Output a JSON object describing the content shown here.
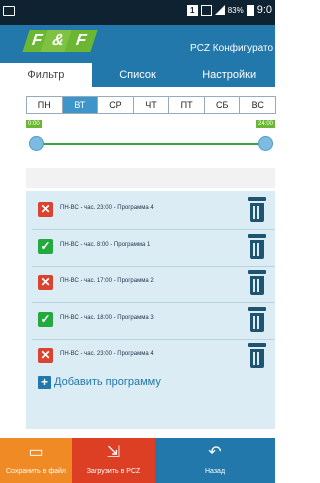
{
  "statusbar": {
    "indicator": "1",
    "battery": "83%",
    "time": "9:0"
  },
  "header": {
    "logo_text": "F&F",
    "title": "PCZ Конфигурато"
  },
  "tabs": [
    {
      "label": "Фильтр"
    },
    {
      "label": "Список"
    },
    {
      "label": "Настройки"
    }
  ],
  "days": [
    "ПН",
    "ВТ",
    "СР",
    "ЧТ",
    "ПТ",
    "СБ",
    "ВС"
  ],
  "selected_day": "ВТ",
  "slider": {
    "start": "0:00",
    "end": "24:00"
  },
  "programs": [
    {
      "text": "ПН-ВС - час. 23:00 - Программа 4",
      "checked": false
    },
    {
      "text": "ПН-ВС - час. 8:00 - Программа 1",
      "checked": true
    },
    {
      "text": "ПН-ВС - час. 17:00 - Программа 2",
      "checked": false
    },
    {
      "text": "ПН-ВС - час. 18:00 - Программа 3",
      "checked": true
    },
    {
      "text": "ПН-ВС - час. 23:00 - Программа 4",
      "checked": false
    }
  ],
  "add_program": "Добавить программу",
  "bottom": {
    "save": "Сохранить в файл",
    "upload": "Загрузить в PCZ",
    "back": "Назад"
  },
  "colors": {
    "primary": "#2277ab",
    "save": "#f08a25",
    "upload": "#dd3f24",
    "checked": "#24a93e",
    "unchecked": "#d9432f"
  }
}
